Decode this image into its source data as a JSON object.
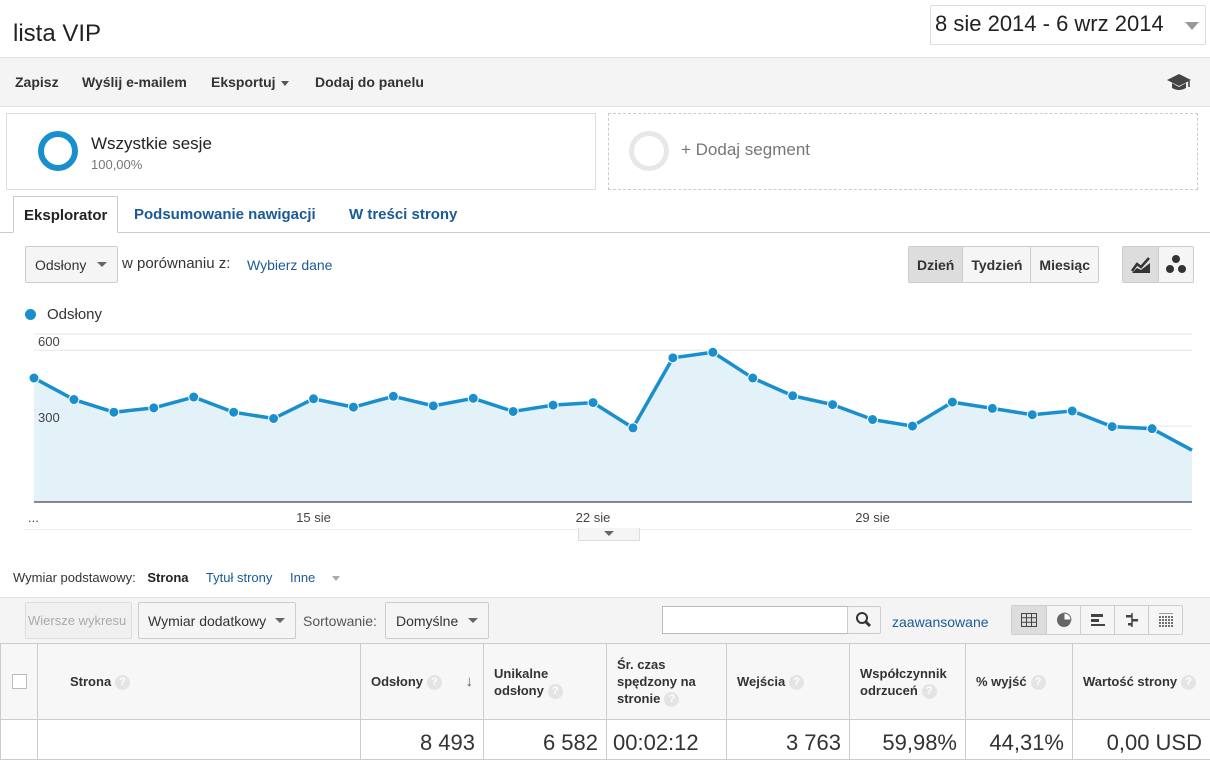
{
  "header": {
    "title": "lista VIP",
    "date_range": "8 sie 2014 - 6 wrz 2014"
  },
  "toolbar": {
    "save": "Zapisz",
    "email": "Wyślij e-mailem",
    "export": "Eksportuj",
    "add_to_dashboard": "Dodaj do panelu"
  },
  "segments": {
    "active_name": "Wszystkie sesje",
    "active_pct": "100,00%",
    "add_label": "+ Dodaj segment"
  },
  "tabs": [
    "Eksplorator",
    "Podsumowanie nawigacji",
    "W treści strony"
  ],
  "controls": {
    "metric": "Odsłony",
    "compare_label": "w porównaniu z:",
    "choose_data": "Wybierz dane",
    "periods": [
      "Dzień",
      "Tydzień",
      "Miesiąc"
    ],
    "active_period": "Dzień"
  },
  "chart_data": {
    "type": "area",
    "legend": "Odsłony",
    "series": [
      {
        "name": "Odsłony",
        "values": [
          490,
          405,
          355,
          372,
          415,
          355,
          330,
          408,
          375,
          418,
          380,
          410,
          358,
          383,
          393,
          293,
          570,
          592,
          490,
          420,
          385,
          326,
          300,
          395,
          370,
          345,
          360,
          298,
          290,
          205
        ]
      }
    ],
    "x_tick_labels": [
      "...",
      "15 sie",
      "22 sie",
      "29 sie"
    ],
    "x_tick_indices": [
      0,
      7,
      14,
      21
    ],
    "y_tick_labels": [
      "600",
      "300"
    ],
    "ylim": [
      0,
      680
    ],
    "color": "#1a8fcd",
    "fill": "#e3f1f9",
    "grid": true
  },
  "dimension": {
    "label": "Wymiar podstawowy:",
    "options": [
      "Strona",
      "Tytuł strony",
      "Inne"
    ],
    "selected": "Strona"
  },
  "table_toolbar": {
    "plot_rows": "Wiersze wykresu",
    "secondary_dim": "Wymiar dodatkowy",
    "sort_label": "Sortowanie:",
    "sort_value": "Domyślne",
    "search_placeholder": "",
    "advanced": "zaawansowane"
  },
  "table": {
    "columns": [
      "Strona",
      "Odsłony",
      "Unikalne odsłony",
      "Śr. czas spędzony na stronie",
      "Wejścia",
      "Współczynnik odrzuceń",
      "% wyjść",
      "Wartość strony"
    ],
    "totals": [
      "",
      "8 493",
      "6 582",
      "00:02:12",
      "3 763",
      "59,98%",
      "44,31%",
      "0,00 USD"
    ]
  }
}
